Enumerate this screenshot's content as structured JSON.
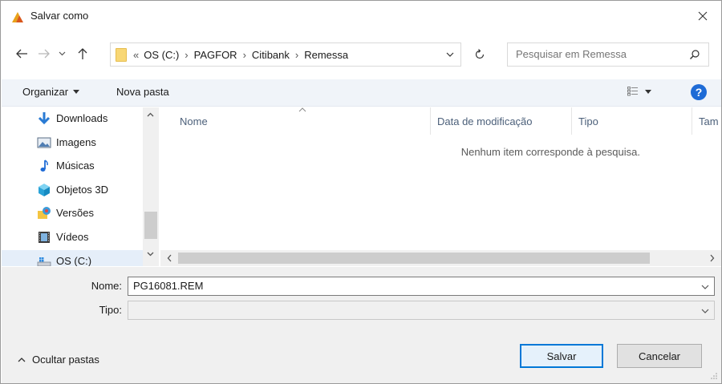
{
  "window": {
    "title": "Salvar como",
    "close_icon": "close-icon"
  },
  "address": {
    "overflow": "«",
    "crumbs": [
      "OS (C:)",
      "PAGFOR",
      "Citibank",
      "Remessa"
    ]
  },
  "search": {
    "placeholder": "Pesquisar em Remessa"
  },
  "toolbar": {
    "organize_label": "Organizar",
    "new_folder_label": "Nova pasta",
    "help_label": "?"
  },
  "sidebar": {
    "items": [
      {
        "label": "Downloads",
        "icon": "download-icon"
      },
      {
        "label": "Imagens",
        "icon": "pictures-icon"
      },
      {
        "label": "Músicas",
        "icon": "music-icon"
      },
      {
        "label": "Objetos 3D",
        "icon": "3d-objects-icon"
      },
      {
        "label": "Versões",
        "icon": "versions-icon"
      },
      {
        "label": "Vídeos",
        "icon": "videos-icon"
      },
      {
        "label": "OS (C:)",
        "icon": "drive-icon"
      }
    ]
  },
  "filelist": {
    "columns": [
      "Nome",
      "Data de modificação",
      "Tipo",
      "Tam"
    ],
    "empty_message": "Nenhum item corresponde à pesquisa."
  },
  "form": {
    "name_label": "Nome:",
    "name_value": "PG16081.REM",
    "type_label": "Tipo:",
    "type_value": ""
  },
  "footer": {
    "toggle_folders_label": "Ocultar pastas",
    "save_label": "Salvar",
    "cancel_label": "Cancelar"
  },
  "colors": {
    "accent": "#0078d7",
    "toolbar_bg": "#f0f4f9",
    "selected_bg": "#e5eef9"
  }
}
